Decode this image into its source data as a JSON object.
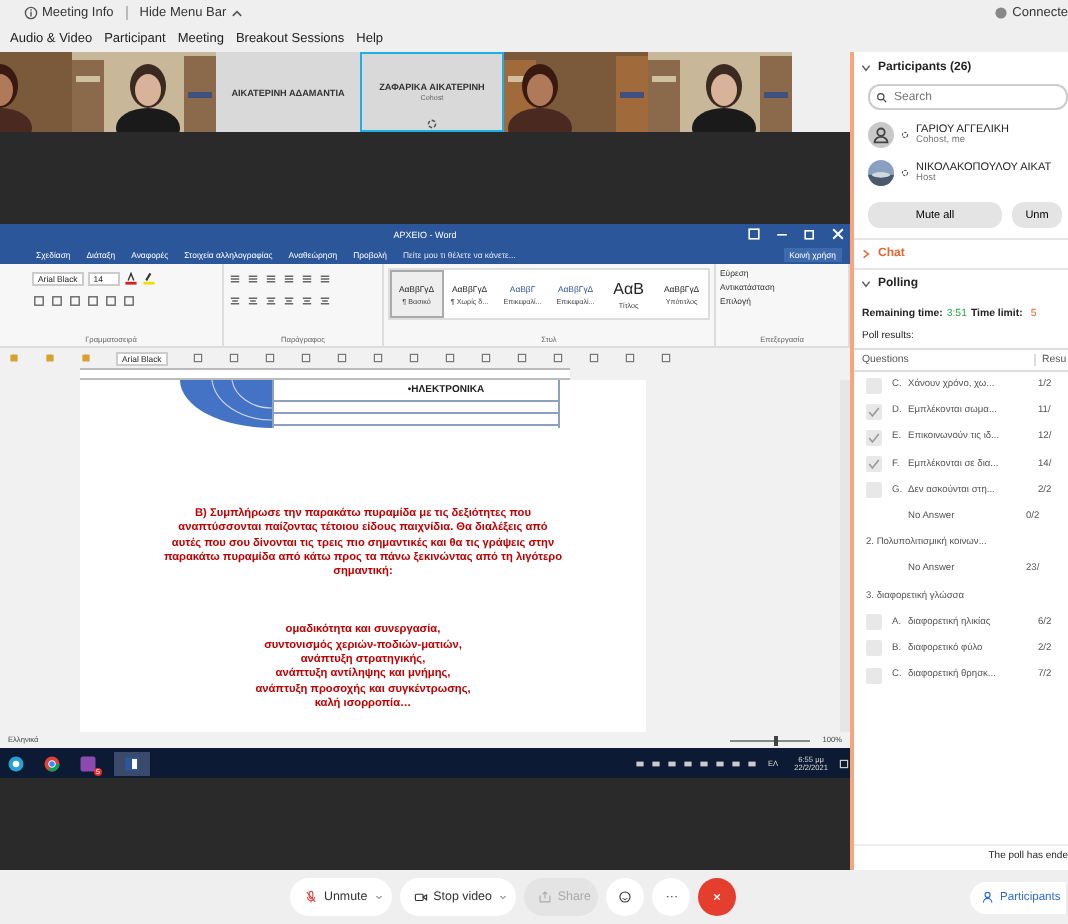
{
  "top_bar": {
    "meeting_info": "Meeting Info",
    "hide_menu": "Hide Menu Bar",
    "status": "Connecte"
  },
  "menu": [
    "Audio & Video",
    "Participant",
    "Meeting",
    "Breakout Sessions",
    "Help"
  ],
  "video_tiles": [
    {
      "kind": "picture",
      "selected": false
    },
    {
      "kind": "picture",
      "selected": false
    },
    {
      "kind": "name",
      "name": "ΑΙΚΑΤΕΡΙΝΗ ΑΔΑΜΑΝΤΙΑ",
      "selected": false
    },
    {
      "kind": "name",
      "name": "ΖΑΦΑΡΙΚΑ ΑΙΚΑΤΕΡΙΝΗ",
      "role": "Cohost",
      "selected": true
    },
    {
      "kind": "picture",
      "selected": false
    },
    {
      "kind": "picture",
      "selected": false
    }
  ],
  "word": {
    "title": "ΑΡΧΕΙΟ - Word",
    "tabs": [
      "Σχεδίαση",
      "Διάταξη",
      "Αναφορές",
      "Στοιχεία αλληλογραφίας",
      "Αναθεώρηση",
      "Προβολή"
    ],
    "tell_me": "Πείτε μου τι θέλετε να κάνετε...",
    "share": "Κοινή χρήση",
    "font": "Arial Black",
    "size": "14",
    "styles": [
      {
        "sample": "ΑαΒβΓγΔ",
        "label": "¶ Βασικό",
        "selected": true
      },
      {
        "sample": "ΑαΒβΓγΔ",
        "label": "¶ Χωρίς δ...",
        "selected": false
      },
      {
        "sample": "ΑαΒβΓ",
        "label": "Επικεφαλί...",
        "selected": false
      },
      {
        "sample": "ΑαΒβΓγΔ",
        "label": "Επικεφαλί...",
        "selected": false
      },
      {
        "sample": "ΑαΒ",
        "label": "Τίτλος",
        "selected": false
      },
      {
        "sample": "ΑαΒβΓγΔ",
        "label": "Υπότιτλος",
        "selected": false
      }
    ],
    "editing": [
      "Εύρεση",
      "Αντικατάσταση",
      "Επιλογή"
    ],
    "groups": [
      "Γραμματοσειρά",
      "Παράγραφος",
      "Στυλ",
      "Επεξεργασία"
    ],
    "qat_font": "Arial Black",
    "table_cell": "•ΗΛΕΚΤΡΟΝΙΚΑ",
    "paragraph": "Β) Συμπλήρωσε την παρακάτω πυραμίδα με τις δεξιότητες που αναπτύσσονται παίζοντας τέτοιου είδους παιχνίδια. Θα διαλέξεις από αυτές που σου δίνονται τις τρεις πιο σημαντικές  και θα τις γράψεις στην παρακάτω πυραμίδα από κάτω προς τα πάνω ξεκινώντας από τη λιγότερο σημαντική:",
    "list": [
      "ομαδικότητα και συνεργασία,",
      "συντονισμός χεριών-ποδιών-ματιών,",
      "ανάπτυξη στρατηγικής,",
      "ανάπτυξη αντίληψης και μνήμης,",
      "ανάπτυξη προσοχής και συγκέντρωσης,",
      "καλή ισορροπία…"
    ],
    "status": {
      "language": "Ελληνικά",
      "zoom": "100%",
      "level": 0.55
    }
  },
  "taskbar": {
    "badge": "5",
    "language": "ΕΛ",
    "time": "6:55 μμ",
    "date": "22/2/2021"
  },
  "panel": {
    "participants": {
      "title": "Participants (26)",
      "expanded": true,
      "search": {
        "placeholder": "Search"
      },
      "people": [
        {
          "name": "ΓΑΡΙΟΥ ΑΓΓΕΛΙΚΗ",
          "role": "Cohost, me",
          "kind": "silhouette"
        },
        {
          "name": "ΝΙΚΟΛΑΚΟΠΟΥΛΟΥ ΑΙΚΑΤ",
          "role": "Host"
        }
      ],
      "buttons": [
        "Mute all",
        "Unm"
      ]
    },
    "chat": {
      "title": "Chat",
      "expanded": false
    },
    "polling": {
      "title": "Polling",
      "expanded": true,
      "remaining_label": "Remaining time:",
      "remaining": "3:51",
      "limit_label": "Time limit:",
      "limit": "5",
      "results_label": "Poll results:",
      "columns": [
        "Questions",
        "Resu"
      ],
      "items": [
        {
          "kind": "answer",
          "letter": "C.",
          "text": "Χάνουν χρόνο, χω...",
          "result": "1/2",
          "checked": false
        },
        {
          "kind": "answer",
          "letter": "D.",
          "text": "Εμπλέκονται σωμα...",
          "result": "11/",
          "checked": true
        },
        {
          "kind": "answer",
          "letter": "E.",
          "text": "Επικοινωνούν τις ιδ...",
          "result": "12/",
          "checked": true
        },
        {
          "kind": "answer",
          "letter": "F.",
          "text": "Εμπλέκονται σε δια...",
          "result": "14/",
          "checked": true
        },
        {
          "kind": "answer",
          "letter": "G.",
          "text": "Δεν ασκούνται στη...",
          "result": "2/2",
          "checked": false
        },
        {
          "kind": "no_answer",
          "text": "No Answer",
          "result": "0/2"
        },
        {
          "kind": "question",
          "text": "2.  Πολυπολιτισμική κοινων..."
        },
        {
          "kind": "no_answer",
          "text": "No Answer",
          "result": "23/"
        },
        {
          "kind": "question",
          "text": "3.  διαφορετική γλώσσα"
        },
        {
          "kind": "answer",
          "letter": "A.",
          "text": "διαφορετική ηλικίας",
          "result": "6/2",
          "checked": false
        },
        {
          "kind": "answer",
          "letter": "B.",
          "text": "διαφορετικό φύλο",
          "result": "2/2",
          "checked": false
        },
        {
          "kind": "answer",
          "letter": "C.",
          "text": "διαφορετική θρησκ...",
          "result": "7/2",
          "checked": false
        }
      ],
      "ended": "The poll has ende"
    }
  },
  "controls": [
    {
      "kind": "mic",
      "label": "Unmute",
      "muted": true
    },
    {
      "kind": "video",
      "label": "Stop video"
    },
    {
      "kind": "share",
      "label": "Share",
      "disabled": true
    },
    {
      "kind": "reactions"
    },
    {
      "kind": "more",
      "label": "···"
    },
    {
      "kind": "end"
    }
  ],
  "participants_button": "Participants"
}
